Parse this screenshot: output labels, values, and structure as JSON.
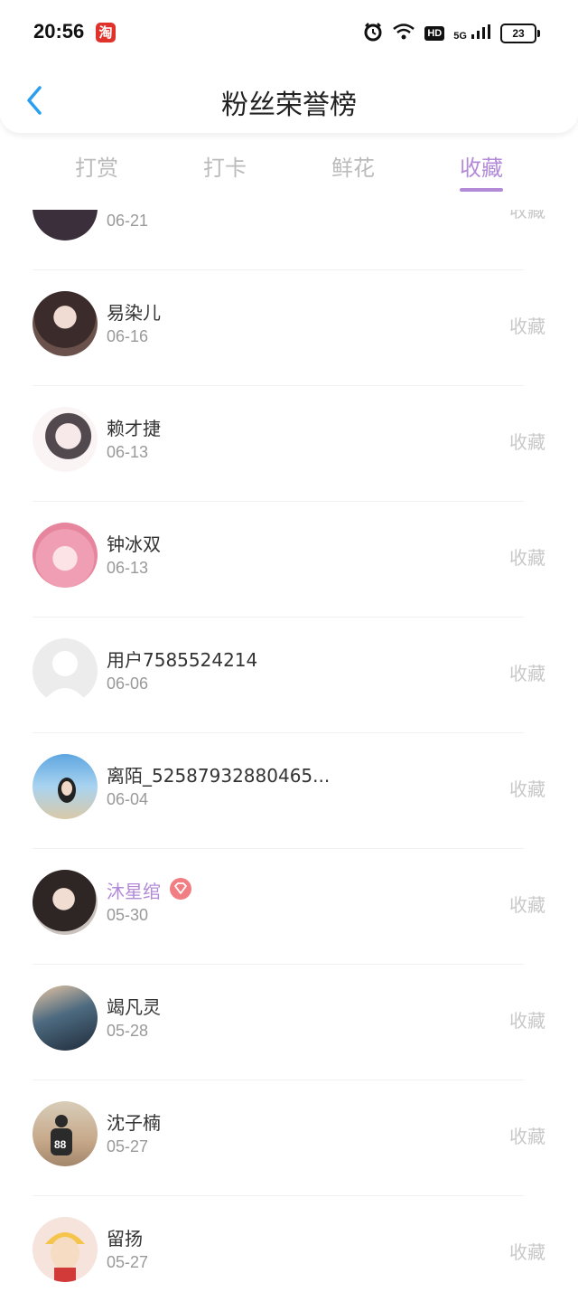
{
  "status": {
    "time": "20:56",
    "app_icon_char": "淘",
    "network": "5G",
    "hd": "HD",
    "battery": "23"
  },
  "header": {
    "title": "粉丝荣誉榜"
  },
  "tabs": [
    {
      "label": "打赏",
      "active": false
    },
    {
      "label": "打卡",
      "active": false
    },
    {
      "label": "鲜花",
      "active": false
    },
    {
      "label": "收藏",
      "active": true
    }
  ],
  "list": [
    {
      "name": "",
      "date": "06-21",
      "action": "收藏",
      "avatar_color": "#3a2f3a"
    },
    {
      "name": "易染儿",
      "date": "06-16",
      "action": "收藏",
      "avatar_color": "#4a3b3a"
    },
    {
      "name": "赖才捷",
      "date": "06-13",
      "action": "收藏",
      "avatar_color": "#f3e6ea"
    },
    {
      "name": "钟冰双",
      "date": "06-13",
      "action": "收藏",
      "avatar_color": "#f2a9b8"
    },
    {
      "name": "用户7585524214",
      "date": "06-06",
      "action": "收藏",
      "avatar_color": "#e8e8e8"
    },
    {
      "name": "离陌_52587932880465...",
      "date": "06-04",
      "action": "收藏",
      "avatar_color": "#7fb6df"
    },
    {
      "name": "沐星绾",
      "date": "05-30",
      "action": "收藏",
      "avatar_color": "#3b3533",
      "vip": true
    },
    {
      "name": "竭凡灵",
      "date": "05-28",
      "action": "收藏",
      "avatar_color": "#3c5466"
    },
    {
      "name": "沈子楠",
      "date": "05-27",
      "action": "收藏",
      "avatar_color": "#b59a7d"
    },
    {
      "name": "留扬",
      "date": "05-27",
      "action": "收藏",
      "avatar_color": "#f0d5c9"
    }
  ],
  "colors": {
    "accent": "#b28ad8",
    "back_arrow": "#2a9ff0",
    "vip_badge": "#f07e82"
  }
}
